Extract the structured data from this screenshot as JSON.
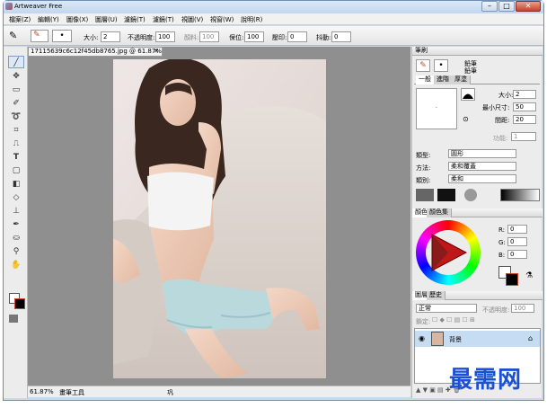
{
  "window": {
    "title": "Artweaver Free",
    "minimize": "–",
    "maximize": "□",
    "close": "✕"
  },
  "menu": [
    "檔案(Z)",
    "編輯(Y)",
    "圖像(X)",
    "圖層(U)",
    "濾鏡(T)",
    "濾鏡(T)",
    "視圖(V)",
    "視窗(W)",
    "說明(R)"
  ],
  "toolbar": {
    "size_label": "大小:",
    "size_value": "2",
    "opacity_label": "不透明度:",
    "opacity_value": "100",
    "blend_label": "顏料:",
    "blend_value": "100",
    "grain_label": "保位:",
    "grain_value": "100",
    "jitter_label": "壓印:",
    "jitter_value": "0",
    "smooth_label": "抖動:",
    "smooth_value": "0"
  },
  "document": {
    "tab_title": "17115639c6c12f45db8765.jpg @ 61.87%",
    "tab_close": "✕",
    "status_zoom": "61.87%",
    "status_tool": "畫筆工具",
    "status_extra": "巩"
  },
  "brush_panel": {
    "title": "筆刷",
    "category": "鉛筆",
    "variant": "鉛筆",
    "tabs": [
      "一般",
      "進階",
      "厚塗"
    ],
    "size_label": "大小:",
    "size_value": "2",
    "min_size_label": "最小尺寸:",
    "min_size_value": "50",
    "spacing_label": "間距:",
    "spacing_value": "20",
    "func_label": "功能:",
    "func_value": "1",
    "type_label": "類型:",
    "type_value": "圓形",
    "method_label": "方法:",
    "method_value": "柔和覆蓋",
    "category_label": "類別:",
    "category_value": "柔和"
  },
  "color_panel": {
    "tabs": [
      "顏色",
      "顏色集"
    ],
    "r_label": "R:",
    "r_value": "0",
    "g_label": "G:",
    "g_value": "0",
    "b_label": "B:",
    "b_value": "0",
    "fg_color": "#ffffff",
    "bg_color": "#000000"
  },
  "layers_panel": {
    "tabs": [
      "圖層",
      "歷史"
    ],
    "blend_mode": "正常",
    "opacity_label": "不透明度:",
    "opacity_value": "100",
    "lock_label": "鎖定:",
    "layer_name": "背景"
  },
  "watermark": "最需网",
  "colors": {
    "accent": "#c4442d",
    "frame": "#c9d9ec",
    "watermark": "#1a4fd6"
  }
}
